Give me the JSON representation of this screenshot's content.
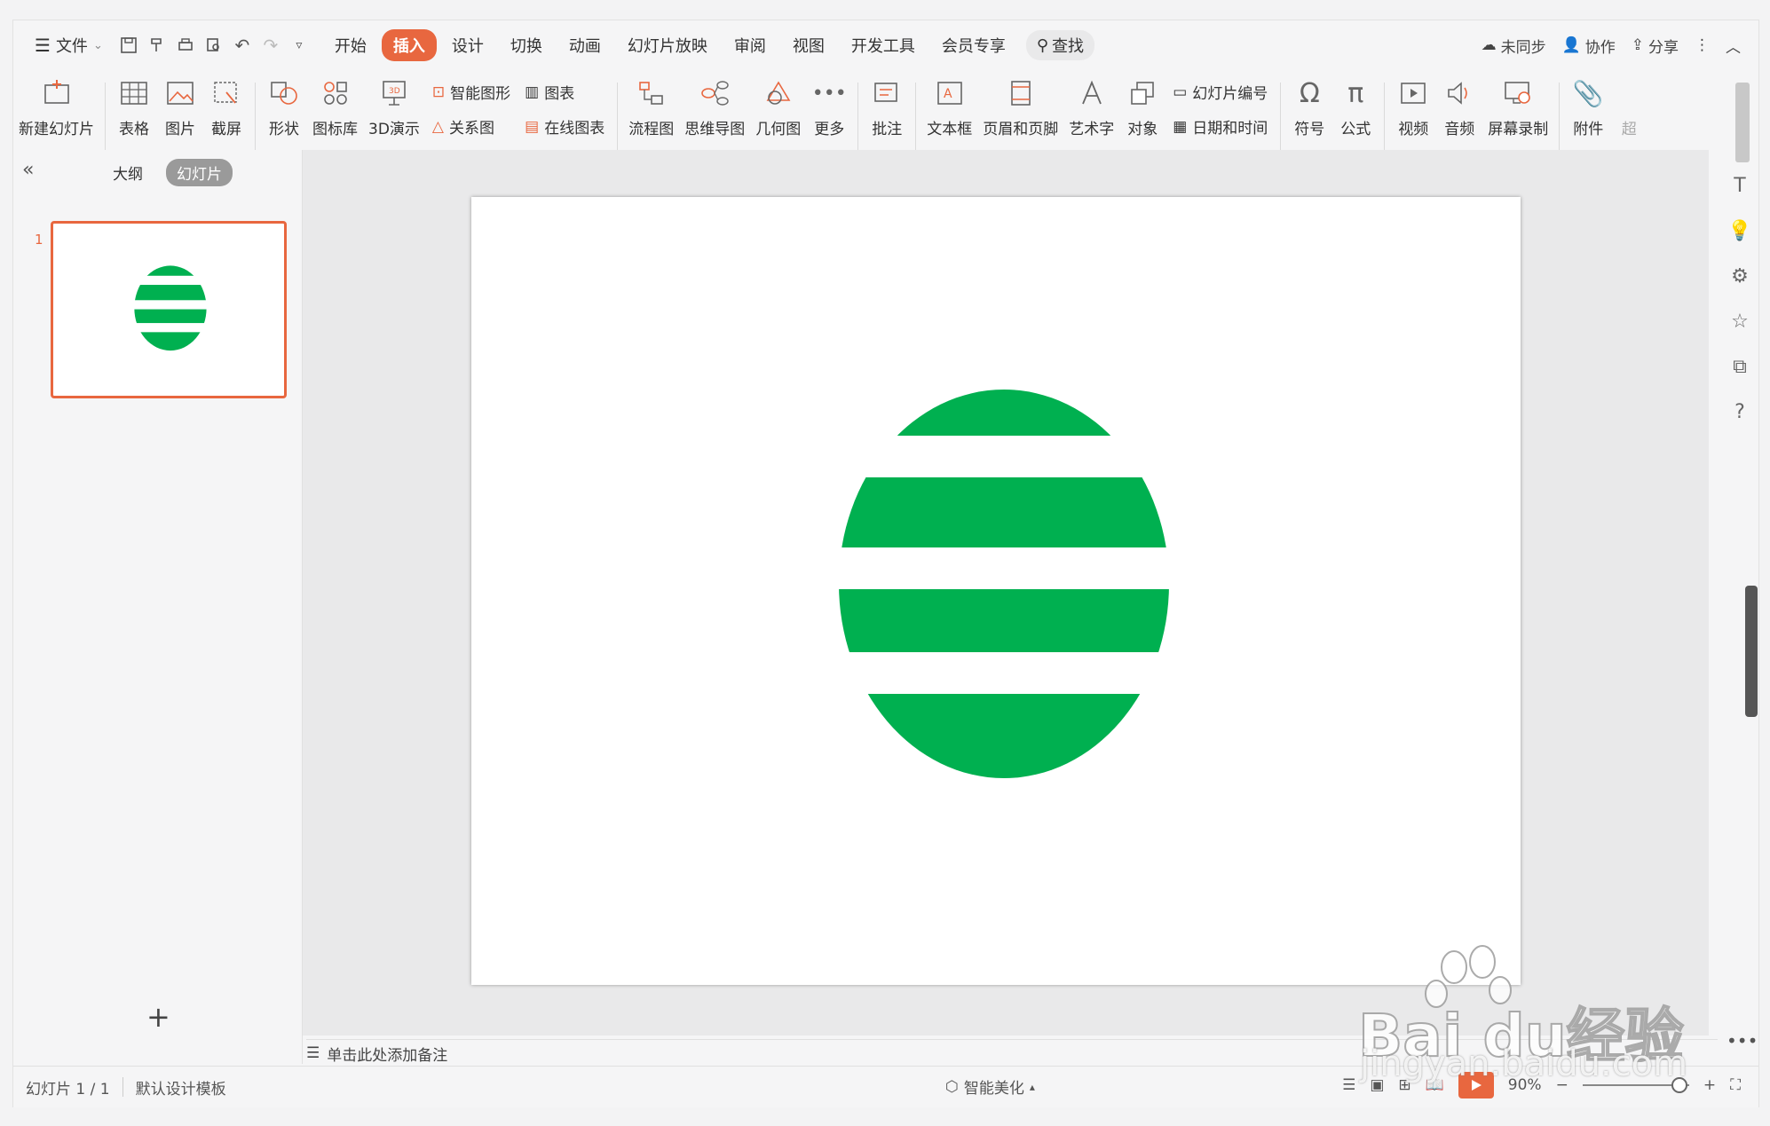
{
  "menu": {
    "file_label": "文件",
    "tabs": [
      {
        "label": "开始",
        "active": false
      },
      {
        "label": "插入",
        "active": true
      },
      {
        "label": "设计",
        "active": false
      },
      {
        "label": "切换",
        "active": false
      },
      {
        "label": "动画",
        "active": false
      },
      {
        "label": "幻灯片放映",
        "active": false
      },
      {
        "label": "审阅",
        "active": false
      },
      {
        "label": "视图",
        "active": false
      },
      {
        "label": "开发工具",
        "active": false
      },
      {
        "label": "会员专享",
        "active": false
      }
    ],
    "search_label": "查找",
    "sync_label": "未同步",
    "collab_label": "协作",
    "share_label": "分享"
  },
  "ribbon": {
    "new_slide": "新建幻灯片",
    "table": "表格",
    "picture": "图片",
    "screenshot": "截屏",
    "shape": "形状",
    "icon_lib": "图标库",
    "three_d": "3D演示",
    "smart_art": "智能图形",
    "chart": "图表",
    "relation": "关系图",
    "online_chart": "在线图表",
    "flowchart": "流程图",
    "mindmap": "思维导图",
    "geometry": "几何图",
    "more": "更多",
    "comment": "批注",
    "textbox": "文本框",
    "header_footer": "页眉和页脚",
    "wordart": "艺术字",
    "object": "对象",
    "slide_number": "幻灯片编号",
    "date_time": "日期和时间",
    "symbol": "符号",
    "formula": "公式",
    "video": "视频",
    "audio": "音频",
    "screen_record": "屏幕录制",
    "attachment": "附件",
    "hyperlink_partial": "超"
  },
  "panel": {
    "outline_tab": "大纲",
    "slides_tab": "幻灯片",
    "slide_number": "1"
  },
  "notes": {
    "placeholder": "单击此处添加备注"
  },
  "status": {
    "slide_counter": "幻灯片 1 / 1",
    "template": "默认设计模板",
    "beautify": "智能美化",
    "zoom": "90%"
  },
  "watermark": {
    "text": "jingyan.baidu.com",
    "logo_text": "Baidu经验"
  },
  "colors": {
    "accent": "#e8673f",
    "shape_green": "#00b050"
  }
}
